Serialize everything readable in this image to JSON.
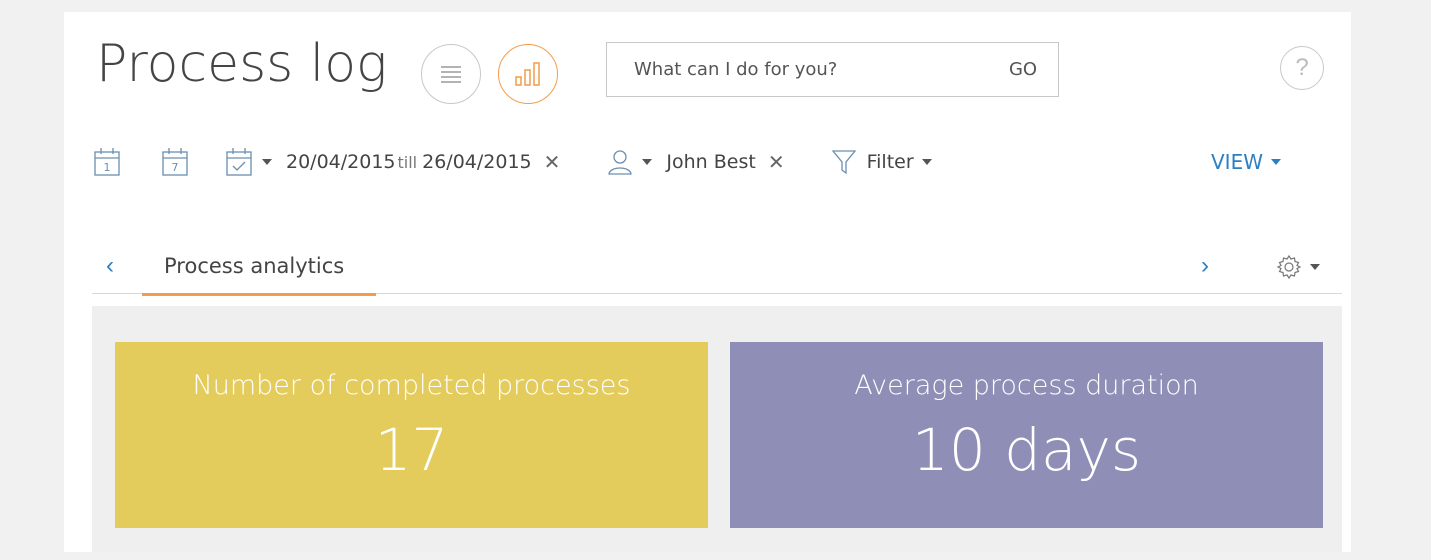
{
  "header": {
    "title": "Process log",
    "list_view_icon": "list-icon",
    "analytics_view_icon": "bar-chart-icon",
    "search": {
      "placeholder": "What can I do for you?",
      "go_label": "GO"
    },
    "help_label": "?"
  },
  "toolbar": {
    "day_icon_label": "1",
    "week_icon_label": "7",
    "date_from": "20/04/2015",
    "till_label": "till",
    "date_to": "26/04/2015",
    "owner": "John Best",
    "filter_label": "Filter",
    "view_label": "VIEW"
  },
  "tabs": {
    "items": [
      {
        "label": "Process analytics",
        "active": true
      }
    ],
    "prev_icon": "chevron-left-icon",
    "next_icon": "chevron-right-icon",
    "settings_icon": "gear-icon"
  },
  "dashboard": {
    "tiles": [
      {
        "title": "Number of completed processes",
        "value": "17",
        "color": "#e4cc5c"
      },
      {
        "title": "Average process duration",
        "value": "10 days",
        "color": "#8f8eb6"
      }
    ]
  },
  "colors": {
    "accent": "#f39c4a",
    "link": "#2d7fc1"
  }
}
